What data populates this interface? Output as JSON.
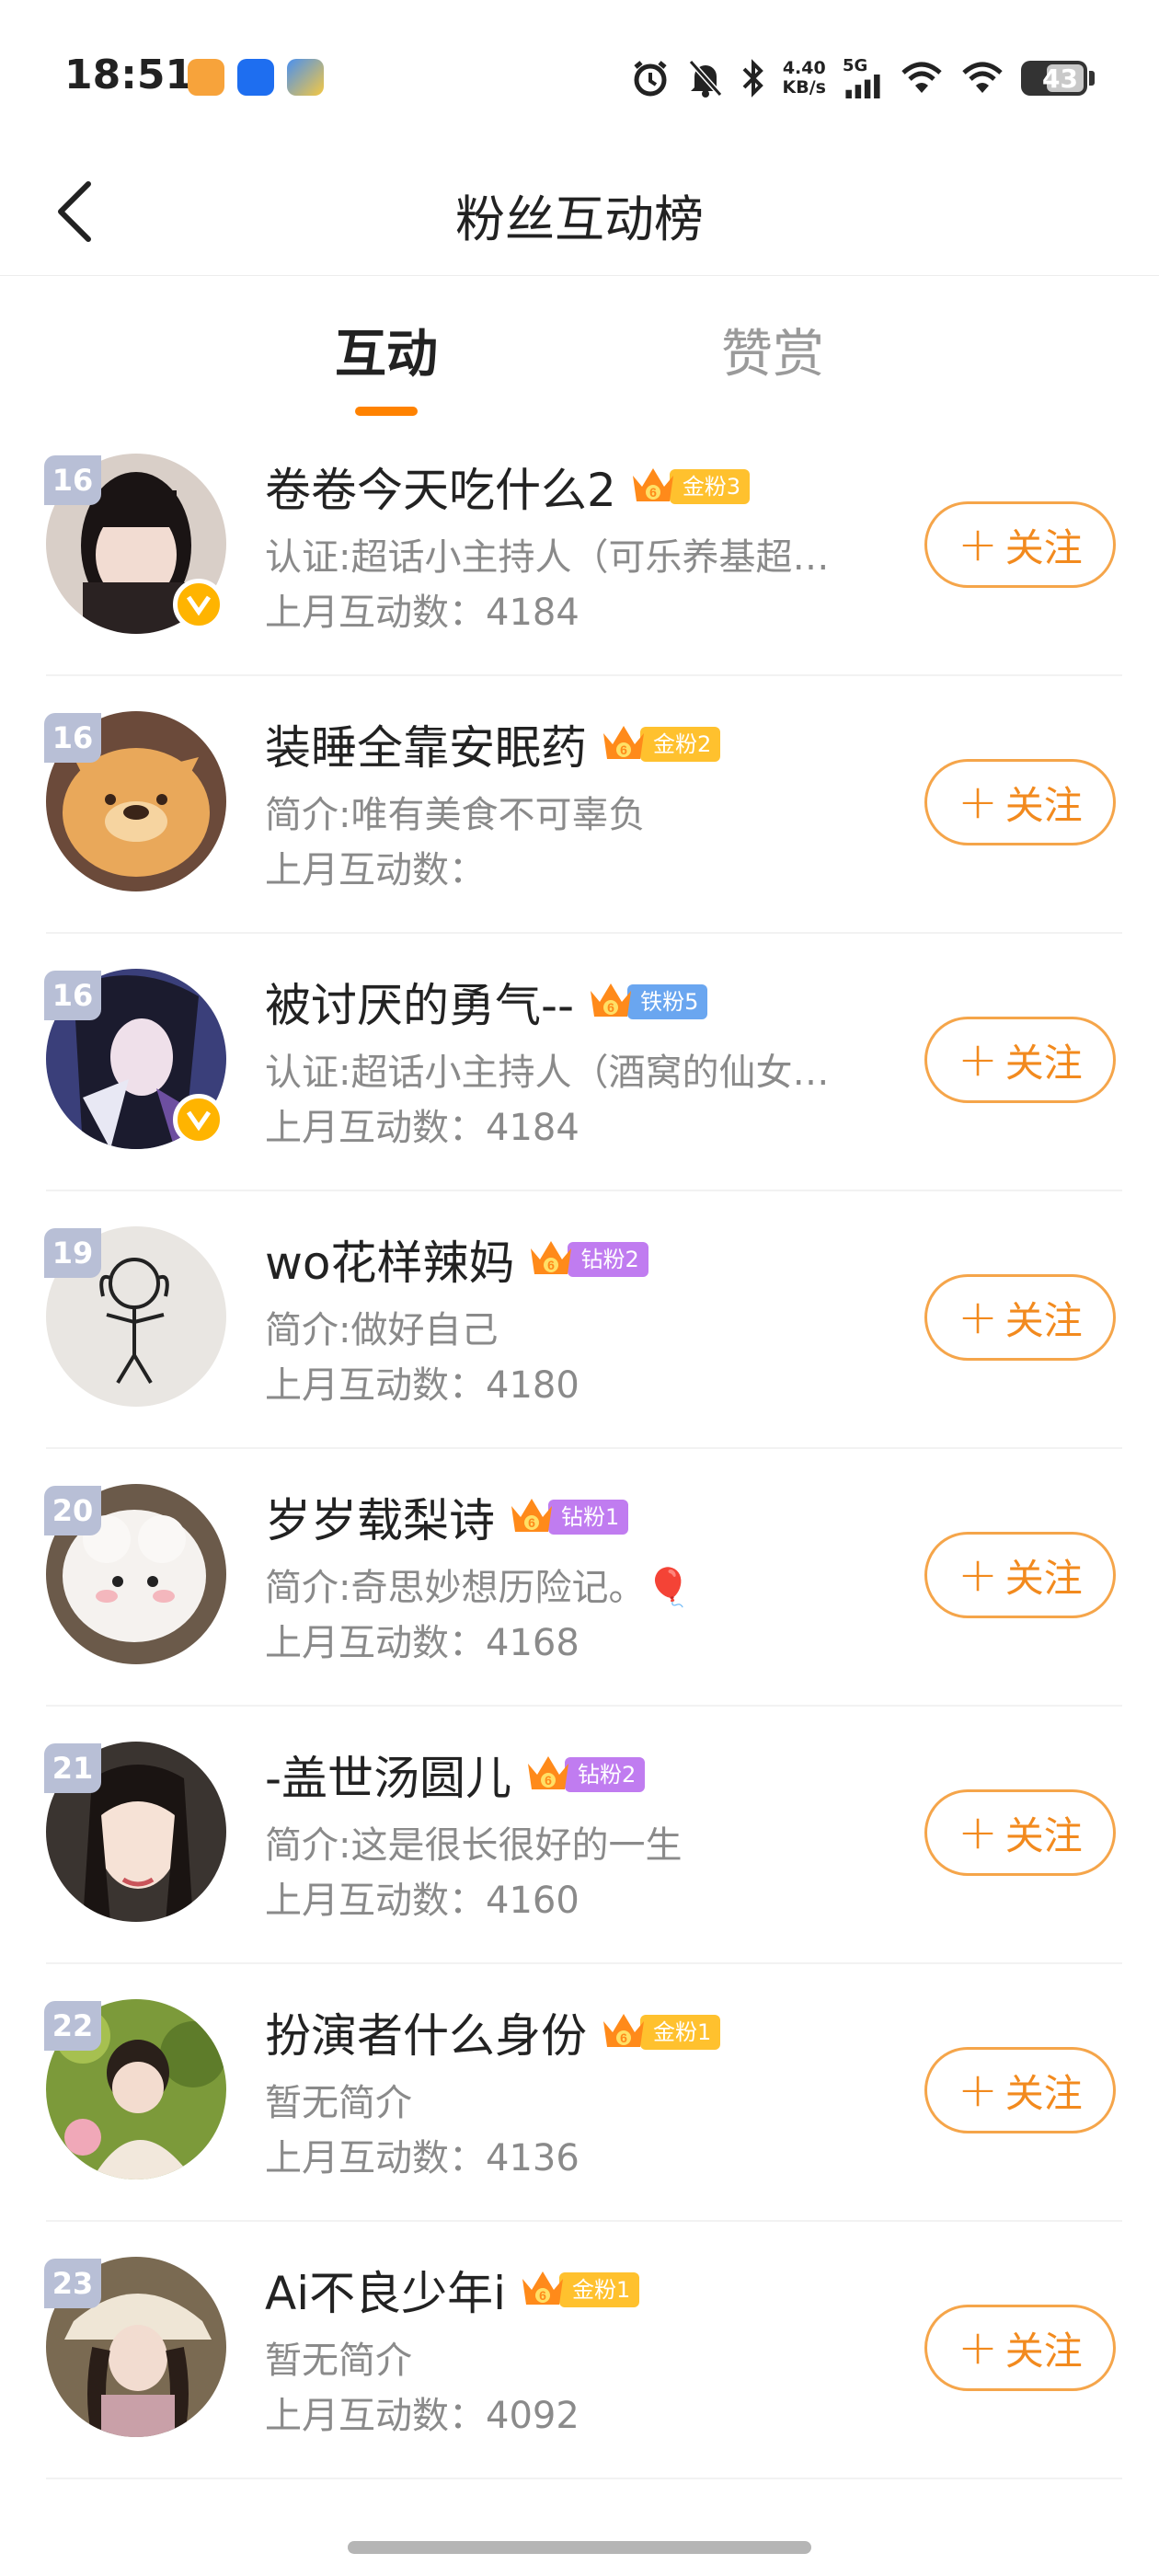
{
  "status_bar": {
    "time": "18:51",
    "net_speed_value": "4.40",
    "net_speed_unit": "KB/s",
    "network_type": "5G",
    "battery": "43",
    "icons": [
      "alarm-icon",
      "mute-icon",
      "bluetooth-icon",
      "signal-icon",
      "wifi-icon",
      "wifi-icon-2",
      "battery-icon"
    ]
  },
  "nav": {
    "title": "粉丝互动榜"
  },
  "tabs": [
    {
      "label": "互动",
      "active": true
    },
    {
      "label": "赞赏",
      "active": false
    }
  ],
  "follow_label": "关注",
  "colors": {
    "accent": "#ff8200",
    "follow_border": "#f5a54a",
    "gold_badge": "#ffc12e",
    "iron_badge": "#6aa6f0",
    "diamond_badge": "#c07cf0",
    "verified": "#ffb400",
    "rank_badge": "#b8bfd6"
  },
  "fans": [
    {
      "rank": "16",
      "name": "卷卷今天吃什么2",
      "badge": "金粉3",
      "badge_type": "gold",
      "desc": "认证:超话小主持人（可乐养基超…",
      "count_label": "上月互动数：4184",
      "verified": true
    },
    {
      "rank": "16",
      "name": "装睡全靠安眠药",
      "badge": "金粉2",
      "badge_type": "gold",
      "desc": "简介:唯有美食不可辜负",
      "count_label": "上月互动数：",
      "verified": false
    },
    {
      "rank": "16",
      "name": "被讨厌的勇气--",
      "badge": "铁粉5",
      "badge_type": "iron",
      "desc": "认证:超话小主持人（酒窝的仙女…",
      "count_label": "上月互动数：4184",
      "verified": true
    },
    {
      "rank": "19",
      "name": "wo花样辣妈",
      "badge": "钻粉2",
      "badge_type": "diamond",
      "desc": "简介:做好自己",
      "count_label": "上月互动数：4180",
      "verified": false
    },
    {
      "rank": "20",
      "name": "岁岁载梨诗",
      "badge": "钻粉1",
      "badge_type": "diamond",
      "desc": "简介:奇思妙想历险记。🎈",
      "count_label": "上月互动数：4168",
      "verified": false
    },
    {
      "rank": "21",
      "name": "-盖世汤圆儿",
      "badge": "钻粉2",
      "badge_type": "diamond",
      "desc": "简介:这是很长很好的一生",
      "count_label": "上月互动数：4160",
      "verified": false
    },
    {
      "rank": "22",
      "name": "扮演者什么身份",
      "badge": "金粉1",
      "badge_type": "gold",
      "desc": "暂无简介",
      "count_label": "上月互动数：4136",
      "verified": false
    },
    {
      "rank": "23",
      "name": "Ai不良少年i",
      "badge": "金粉1",
      "badge_type": "gold",
      "desc": "暂无简介",
      "count_label": "上月互动数：4092",
      "verified": false
    }
  ]
}
